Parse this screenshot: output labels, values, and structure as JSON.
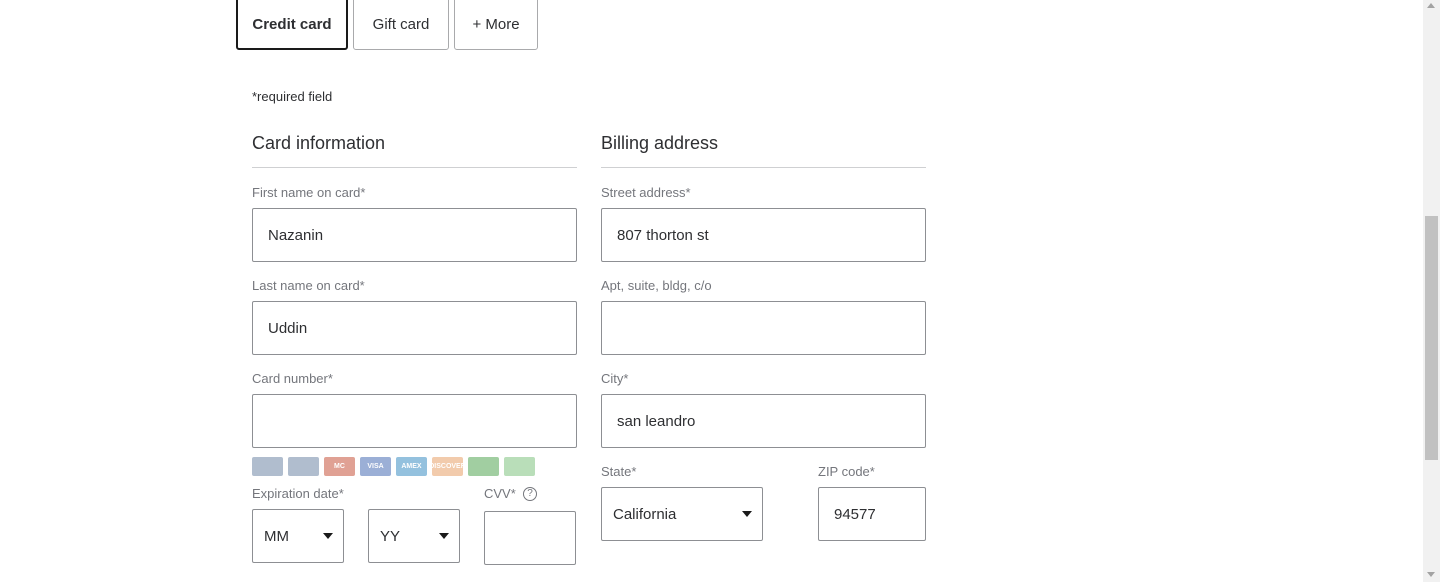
{
  "payment_tabs": [
    {
      "label": "Credit card",
      "active": true
    },
    {
      "label": "Gift card",
      "active": false
    },
    {
      "label": "+ More",
      "active": false
    }
  ],
  "required_note": "*required field",
  "card_info": {
    "title": "Card information",
    "first_name": {
      "label": "First name on card*",
      "value": "Nazanin"
    },
    "last_name": {
      "label": "Last name on card*",
      "value": "Uddin"
    },
    "card_number": {
      "label": "Card number*",
      "value": ""
    },
    "card_brands": [
      {
        "icon": "generic-card-icon",
        "color": "#6f86a6",
        "text": ""
      },
      {
        "icon": "generic-card-icon",
        "color": "#6f86a6",
        "text": ""
      },
      {
        "icon": "mastercard-icon",
        "color": "#c8553d",
        "text": "MC"
      },
      {
        "icon": "visa-icon",
        "color": "#4a6fb5",
        "text": "VISA"
      },
      {
        "icon": "amex-icon",
        "color": "#3e8fc4",
        "text": "AMEX"
      },
      {
        "icon": "discover-icon",
        "color": "#e8a26a",
        "text": "DISCOVER"
      },
      {
        "icon": "store-card-icon",
        "color": "#53a653",
        "text": ""
      },
      {
        "icon": "store-card-icon",
        "color": "#7fc37f",
        "text": ""
      }
    ],
    "expiration": {
      "label": "Expiration date*",
      "month": "MM",
      "year": "YY"
    },
    "cvv": {
      "label": "CVV*",
      "value": "",
      "help_icon": "question-circle-icon"
    }
  },
  "billing": {
    "title": "Billing address",
    "street": {
      "label": "Street address*",
      "value": "807 thorton st"
    },
    "apt": {
      "label": "Apt, suite, bldg, c/o",
      "value": ""
    },
    "city": {
      "label": "City*",
      "value": "san leandro"
    },
    "state": {
      "label": "State*",
      "value": "California"
    },
    "zip": {
      "label": "ZIP code*",
      "value": "94577"
    }
  }
}
